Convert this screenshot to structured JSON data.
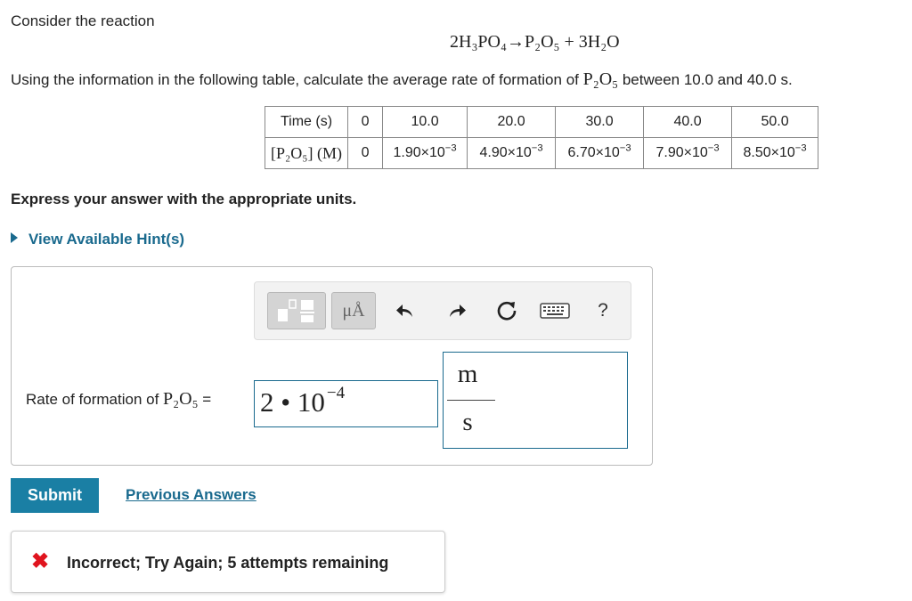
{
  "intro": "Consider the reaction",
  "equation": {
    "lhs_coef": "2",
    "lhs_species": "H₃PO₄",
    "arrow": "→",
    "rhs_1": "P₂O₅",
    "plus": "+",
    "rhs_coef": "3",
    "rhs_2": "H₂O"
  },
  "question": {
    "before": "Using the information in the following table, calculate the average rate of formation of ",
    "species": "P₂O₅",
    "after": " between 10.0 and 40.0 s."
  },
  "table": {
    "row1_label": "Time (s)",
    "times": [
      "0",
      "10.0",
      "20.0",
      "30.0",
      "40.0",
      "50.0"
    ],
    "row2_label": "[P₂O₅] (M)",
    "conc_zero": "0",
    "conc_mantissas": [
      "1.90",
      "4.90",
      "6.70",
      "7.90",
      "8.50"
    ],
    "times_ten": "×10",
    "conc_exponent": "−3"
  },
  "express": "Express your answer with the appropriate units.",
  "hint": "View Available Hint(s)",
  "toolbar": {
    "units_label": "μÅ",
    "help_label": "?"
  },
  "answer": {
    "label_before": "Rate of formation of ",
    "label_species": "P₂O₅",
    "label_after": " =",
    "value_mantissa": "2",
    "value_dot": "•",
    "value_base": "10",
    "value_exponent": "−4",
    "unit_numerator": "m",
    "unit_denominator": "s"
  },
  "submit_label": "Submit",
  "previous_answers_label": "Previous Answers",
  "feedback": {
    "icon": "✖",
    "text": "Incorrect; Try Again; 5 attempts remaining"
  },
  "colors": {
    "link": "#1a6a8e",
    "submit_bg": "#1a7fa4",
    "error": "#e0141e",
    "input_border": "#1a6a8e"
  }
}
